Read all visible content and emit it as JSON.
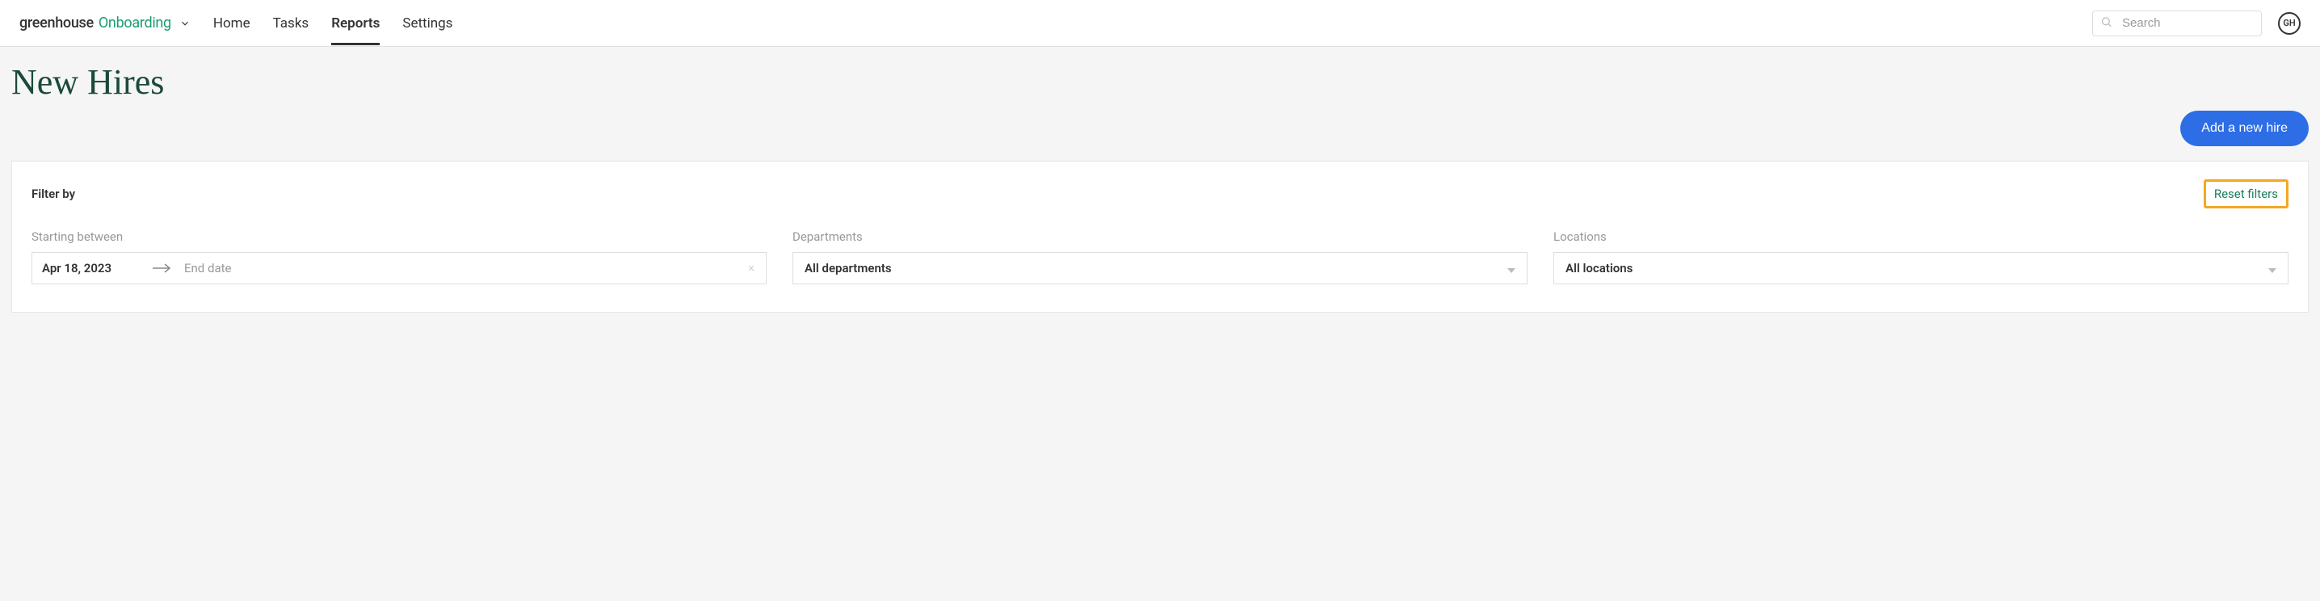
{
  "header": {
    "logo1": "greenhouse",
    "logo2": "Onboarding",
    "nav": {
      "home": "Home",
      "tasks": "Tasks",
      "reports": "Reports",
      "settings": "Settings"
    },
    "search_placeholder": "Search",
    "avatar_initials": "GH"
  },
  "page": {
    "title": "New Hires",
    "add_button": "Add a new hire"
  },
  "filters": {
    "heading": "Filter by",
    "reset": "Reset filters",
    "starting_label": "Starting between",
    "start_date": "Apr 18, 2023",
    "end_date_placeholder": "End date",
    "departments_label": "Departments",
    "departments_value": "All departments",
    "locations_label": "Locations",
    "locations_value": "All locations"
  }
}
